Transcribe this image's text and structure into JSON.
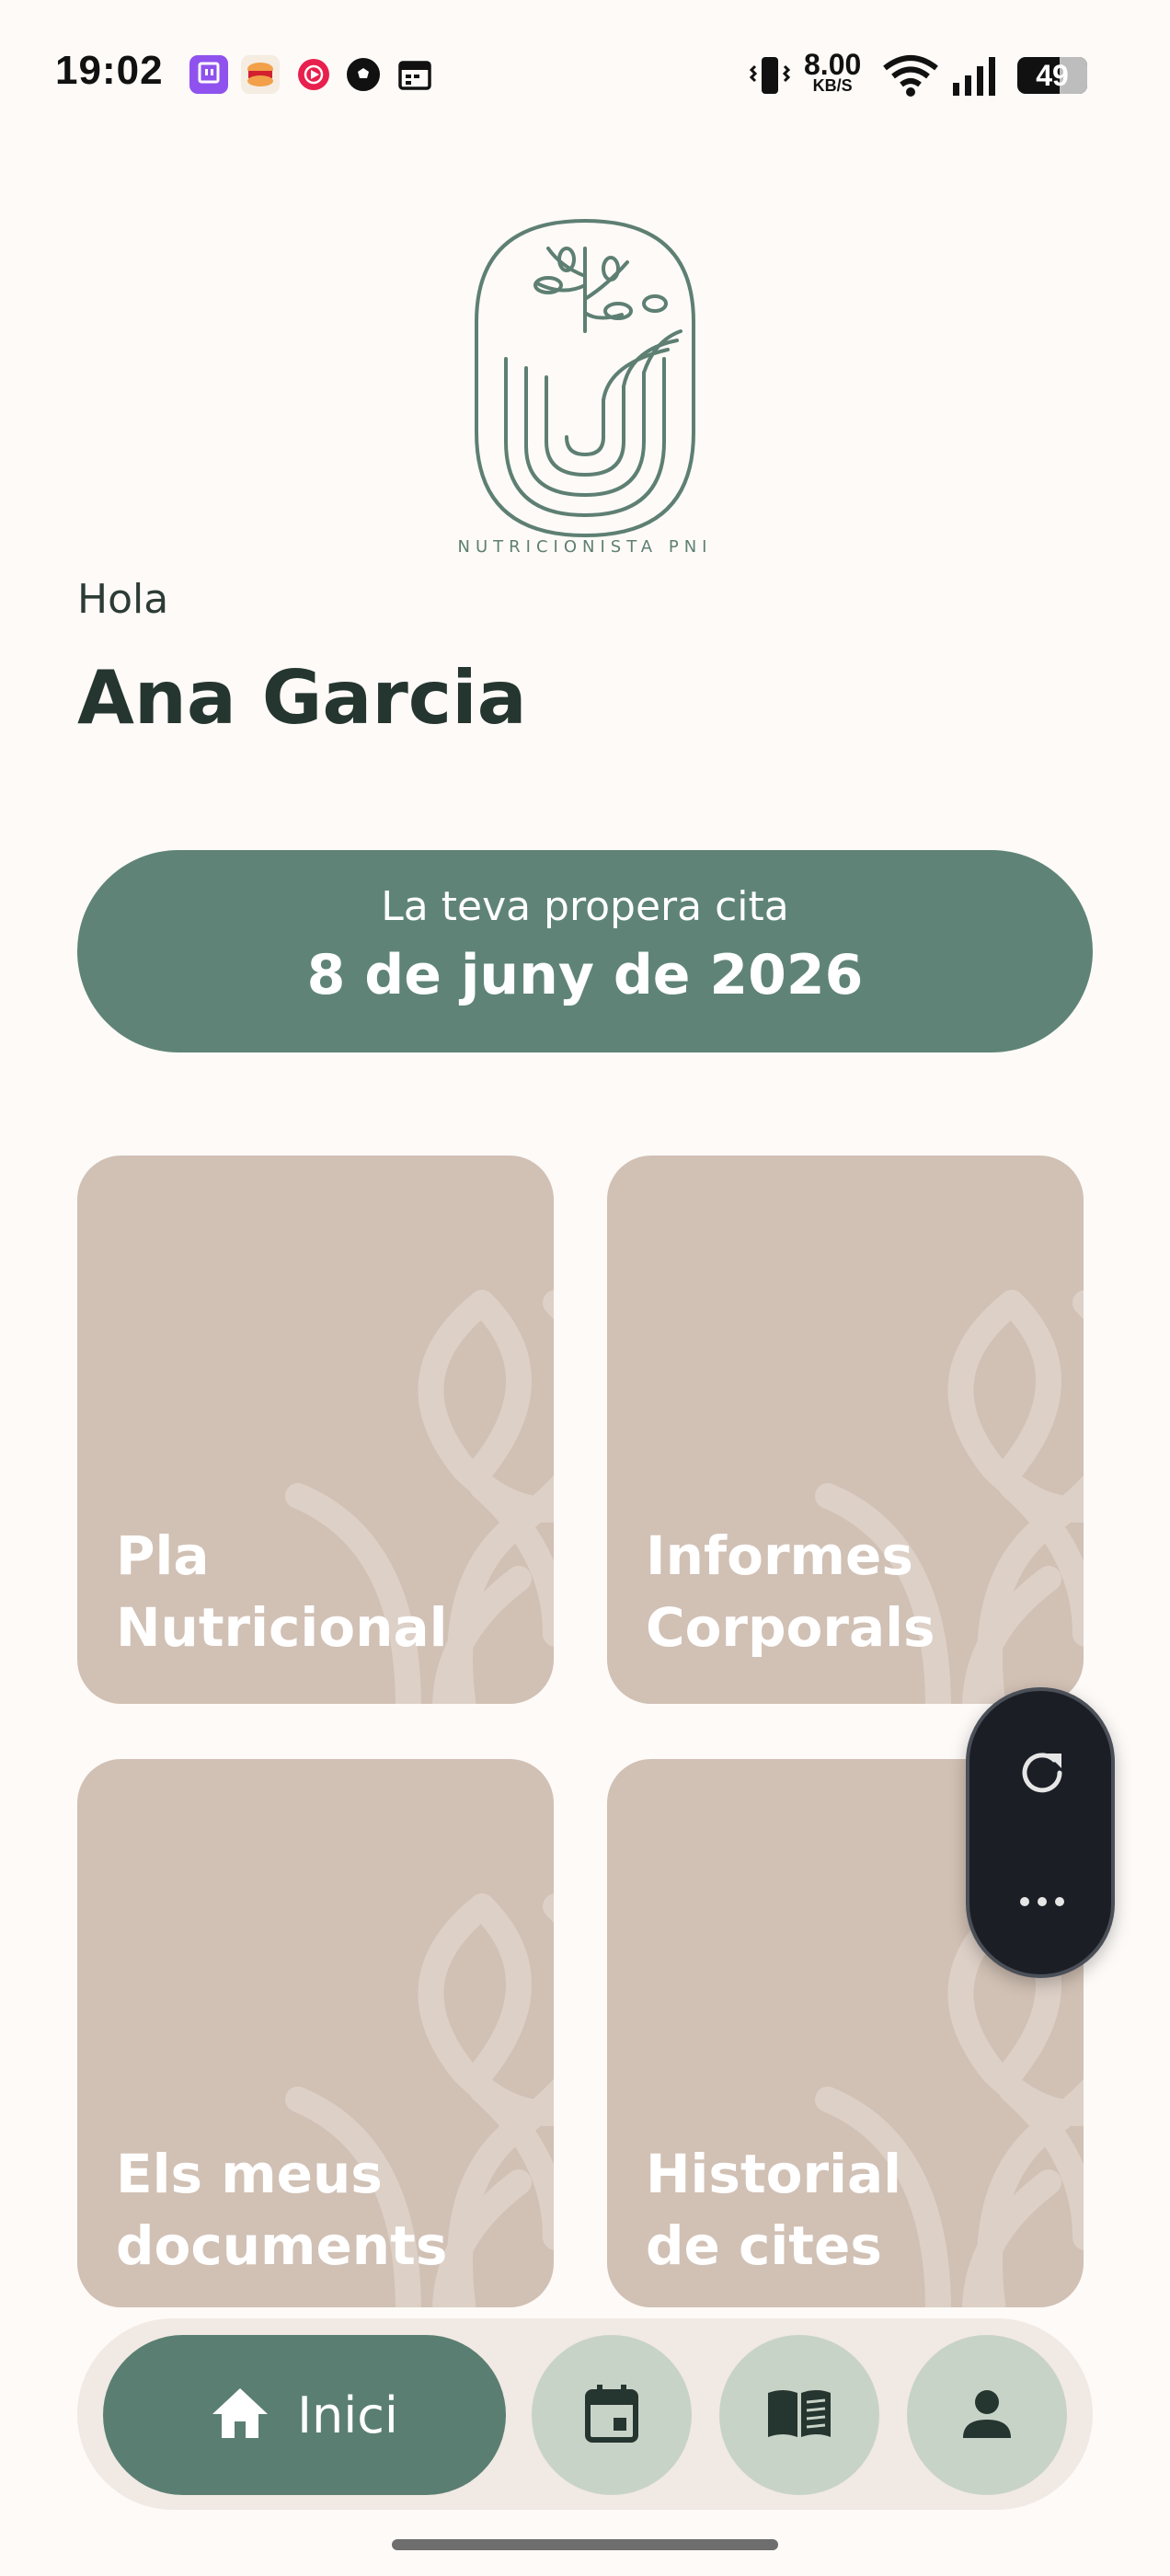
{
  "status_bar": {
    "time": "19:02",
    "net_speed_value": "8.00",
    "net_speed_unit": "KB/S",
    "battery": "49",
    "notification_icons": [
      "twitch-icon",
      "burger-king-icon",
      "youtube-music-icon",
      "football-icon",
      "calendar-app-icon"
    ],
    "system_icons": [
      "vibrate-icon",
      "wifi-icon",
      "signal-icon",
      "battery-icon"
    ]
  },
  "logo": {
    "text": "NUTRICIONISTA PNI"
  },
  "greeting": {
    "hello": "Hola",
    "name": "Ana Garcia"
  },
  "appointment": {
    "label": "La teva propera cita",
    "date": "8 de juny de 2026"
  },
  "tiles": [
    {
      "line1": "Pla",
      "line2": "Nutricional"
    },
    {
      "line1": "Informes",
      "line2": "Corporals"
    },
    {
      "line1": "Els meus",
      "line2": "documents"
    },
    {
      "line1": "Historial",
      "line2": "de cites"
    }
  ],
  "floating_controls": {
    "icons": [
      "refresh-icon",
      "more-icon"
    ]
  },
  "bottom_nav": {
    "home_label": "Inici",
    "icons": [
      "home-icon",
      "calendar-icon",
      "book-icon",
      "person-icon"
    ]
  },
  "colors": {
    "background": "#fdfaf7",
    "accent_green": "#5f8477",
    "tile": "#d1c0b4",
    "nav_round": "#c8d3c8",
    "text_dark": "#25352f"
  }
}
